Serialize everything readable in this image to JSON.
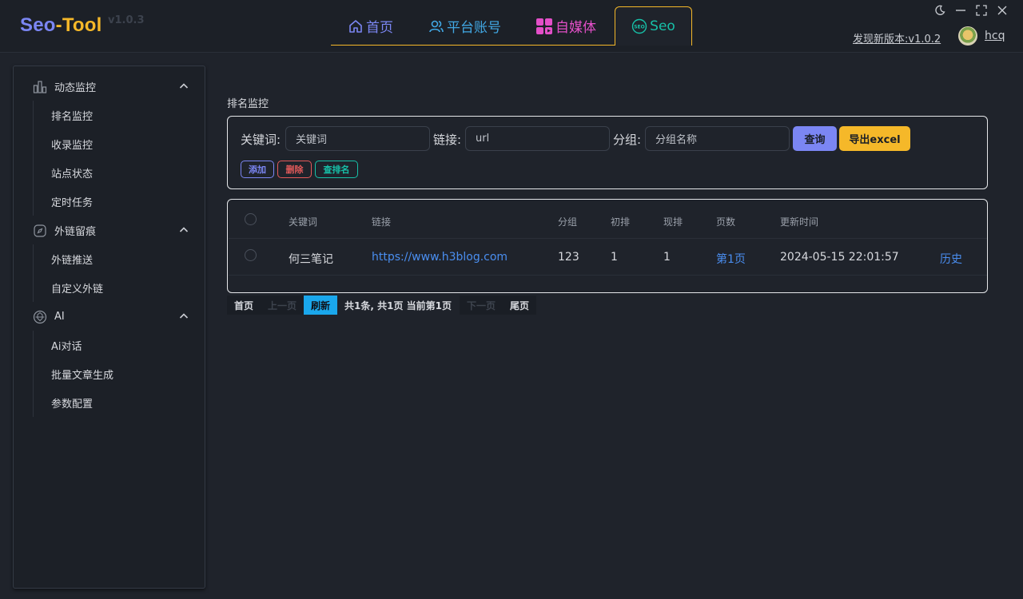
{
  "app": {
    "brand_seo": "Seo",
    "brand_dash": "-",
    "brand_tool": "Tool",
    "version": "v1.0.3",
    "update_link": "发现新版本:v1.0.2",
    "username": "hcq"
  },
  "tabs": [
    {
      "label": "首页",
      "icon": "home-icon",
      "color": "#7b86f3"
    },
    {
      "label": "平台账号",
      "icon": "users-icon",
      "color": "#41a7e3"
    },
    {
      "label": "自媒体",
      "icon": "apps-icon",
      "color": "#e34fc8"
    },
    {
      "label": "Seo",
      "icon": "seo-icon",
      "color": "#17c0a8",
      "active": true
    }
  ],
  "window_controls": [
    "moon-icon",
    "minimize-icon",
    "fullscreen-icon",
    "close-icon"
  ],
  "sidebar": {
    "groups": [
      {
        "label": "动态监控",
        "icon": "chart-icon",
        "items": [
          "排名监控",
          "收录监控",
          "站点状态",
          "定时任务"
        ]
      },
      {
        "label": "外链留痕",
        "icon": "compass-icon",
        "items": [
          "外链推送",
          "自定义外链"
        ]
      },
      {
        "label": "AI",
        "icon": "ai-icon",
        "items": [
          "Ai对话",
          "批量文章生成",
          "参数配置"
        ]
      }
    ]
  },
  "main": {
    "title": "排名监控",
    "filters": {
      "keyword_label": "关键词:",
      "keyword_placeholder": "关键词",
      "link_label": "链接:",
      "link_placeholder": "url",
      "group_label": "分组:",
      "group_placeholder": "分组名称",
      "query_button": "查询",
      "export_button": "导出excel",
      "add_button": "添加",
      "delete_button": "删除",
      "check_rank_button": "查排名"
    },
    "table": {
      "headers": [
        "关键词",
        "链接",
        "分组",
        "初排",
        "现排",
        "页数",
        "更新时间"
      ],
      "rows": [
        {
          "keyword": "何三笔记",
          "link": "https://www.h3blog.com",
          "group": "123",
          "initial": "1",
          "current": "1",
          "page": "第1页",
          "updated": "2024-05-15 22:01:57",
          "action": "历史"
        }
      ]
    },
    "pager": {
      "first": "首页",
      "prev": "上一页",
      "refresh": "刷新",
      "info": "共1条, 共1页 当前第1页",
      "next": "下一页",
      "last": "尾页"
    }
  },
  "colors": {
    "accent_purple": "#7b86f3",
    "accent_yellow": "#f5b829",
    "accent_teal": "#17c0a8",
    "accent_red": "#e35a5a",
    "link_blue": "#4a8ef0",
    "refresh_blue": "#1aa7ec"
  }
}
